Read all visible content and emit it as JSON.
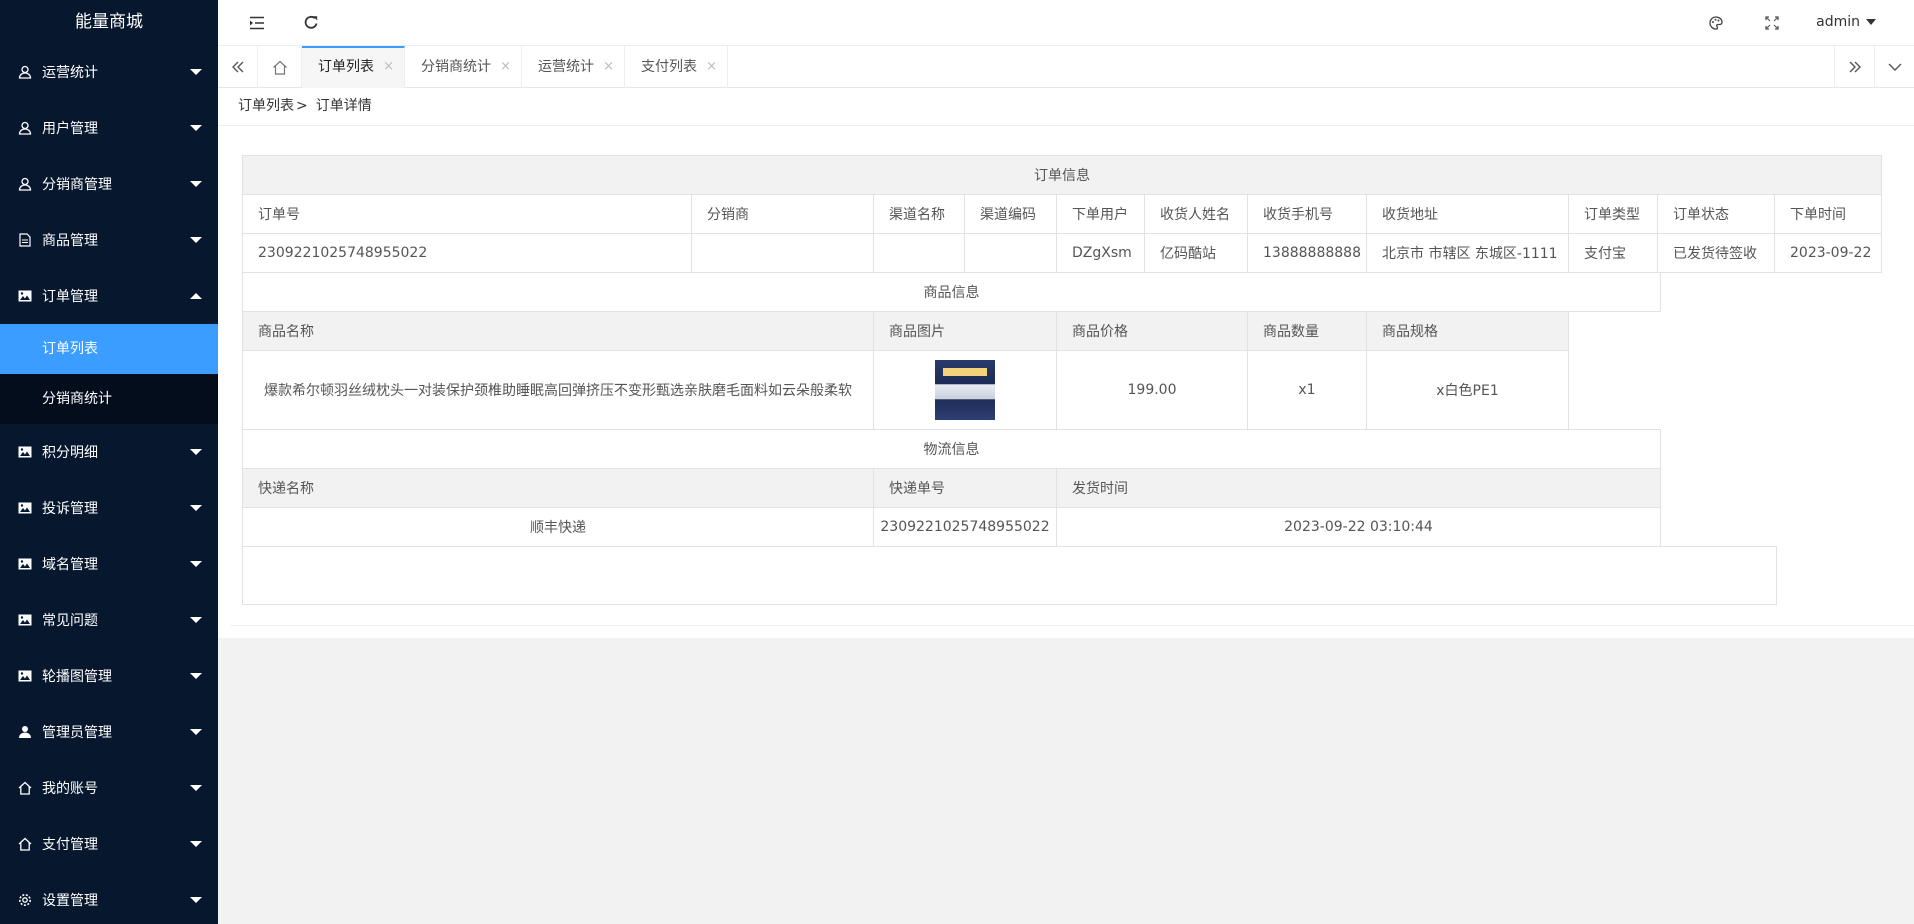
{
  "app": {
    "title": "能量商城"
  },
  "sidebar": {
    "items": [
      {
        "label": "运营统计",
        "icon": "user-icon",
        "expanded": false
      },
      {
        "label": "用户管理",
        "icon": "user-icon",
        "expanded": false
      },
      {
        "label": "分销商管理",
        "icon": "user-icon",
        "expanded": false
      },
      {
        "label": "商品管理",
        "icon": "file-icon",
        "expanded": false
      },
      {
        "label": "订单管理",
        "icon": "image-icon",
        "expanded": true,
        "children": [
          {
            "label": "订单列表",
            "active": true
          },
          {
            "label": "分销商统计",
            "active": false
          }
        ]
      },
      {
        "label": "积分明细",
        "icon": "image-icon",
        "expanded": false
      },
      {
        "label": "投诉管理",
        "icon": "image-icon",
        "expanded": false
      },
      {
        "label": "域名管理",
        "icon": "image-icon",
        "expanded": false
      },
      {
        "label": "常见问题",
        "icon": "image-icon",
        "expanded": false
      },
      {
        "label": "轮播图管理",
        "icon": "image-icon",
        "expanded": false
      },
      {
        "label": "管理员管理",
        "icon": "person-icon",
        "expanded": false
      },
      {
        "label": "我的账号",
        "icon": "home-icon",
        "expanded": false
      },
      {
        "label": "支付管理",
        "icon": "home-icon",
        "expanded": false
      },
      {
        "label": "设置管理",
        "icon": "gear-icon",
        "expanded": false
      }
    ]
  },
  "header": {
    "user": "admin",
    "icons": [
      "menu-fold-icon",
      "refresh-icon",
      "palette-icon",
      "fullscreen-icon"
    ]
  },
  "tabs": {
    "items": [
      {
        "label": "订单列表",
        "active": true
      },
      {
        "label": "分销商统计",
        "active": false
      },
      {
        "label": "运营统计",
        "active": false
      },
      {
        "label": "支付列表",
        "active": false
      }
    ],
    "close_glyph": "×"
  },
  "breadcrumb": {
    "parent": "订单列表",
    "separator": ">",
    "current": "订单详情"
  },
  "order": {
    "section_title": "订单信息",
    "headers": [
      "订单号",
      "分销商",
      "渠道名称",
      "渠道编码",
      "下单用户",
      "收货人姓名",
      "收货手机号",
      "收货地址",
      "订单类型",
      "订单状态",
      "下单时间"
    ],
    "row": [
      "2309221025748955022",
      "",
      "",
      "",
      "DZgXsm",
      "亿码酷站",
      "13888888888",
      "北京市 市辖区 东城区-1111",
      "支付宝",
      "已发货待签收",
      "2023-09-22"
    ]
  },
  "goods": {
    "section_title": "商品信息",
    "headers": [
      "商品名称",
      "商品图片",
      "商品价格",
      "商品数量",
      "商品规格"
    ],
    "row": {
      "name": "爆款希尔顿羽丝绒枕头一对装保护颈椎助睡眠高回弹挤压不变形甄选亲肤磨毛面料如云朵般柔软",
      "image": "pillow-product-image",
      "price": "199.00",
      "quantity": "x1",
      "spec": "x白色PE1"
    }
  },
  "logistics": {
    "section_title": "物流信息",
    "headers": [
      "快递名称",
      "快递单号",
      "发货时间"
    ],
    "row": [
      "顺丰快递",
      "2309221025748955022",
      "2023-09-22 03:10:44"
    ]
  },
  "colors": {
    "sidebar_bg": "#06172e",
    "active_item": "#3a9dff",
    "header_cell_bg": "#f2f2f2"
  }
}
